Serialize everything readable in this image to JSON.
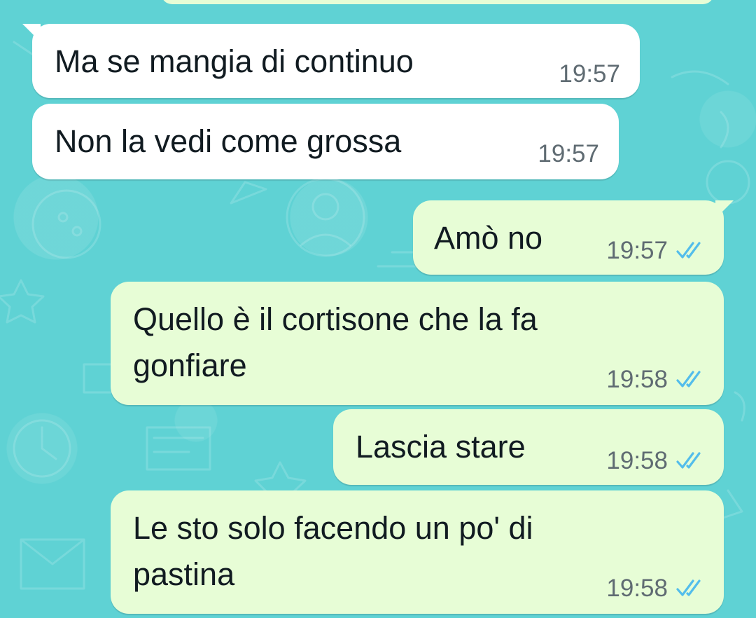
{
  "messages": [
    {
      "id": "m1",
      "direction": "incoming",
      "text": "Ma se mangia di continuo",
      "time": "19:57"
    },
    {
      "id": "m2",
      "direction": "incoming",
      "text": "Non la vedi come grossa",
      "time": "19:57"
    },
    {
      "id": "m3",
      "direction": "outgoing",
      "text": "Amò no",
      "time": "19:57",
      "status": "read"
    },
    {
      "id": "m4",
      "direction": "outgoing",
      "lines": [
        "Quello è il cortisone che la fa",
        "gonfiare"
      ],
      "time": "19:58",
      "status": "read"
    },
    {
      "id": "m5",
      "direction": "outgoing",
      "text": "Lascia stare",
      "time": "19:58",
      "status": "read"
    },
    {
      "id": "m6",
      "direction": "outgoing",
      "lines": [
        "Le sto solo facendo un po' di",
        "pastina"
      ],
      "time": "19:58",
      "status": "read"
    }
  ],
  "icons": {
    "read_receipt": "double-check-icon"
  },
  "colors": {
    "wallpaper": "#5fd2d4",
    "incoming_bubble": "#ffffff",
    "outgoing_bubble": "#e7fdd6",
    "read_ticks": "#53bdeb",
    "timestamp": "#5f6b72"
  }
}
